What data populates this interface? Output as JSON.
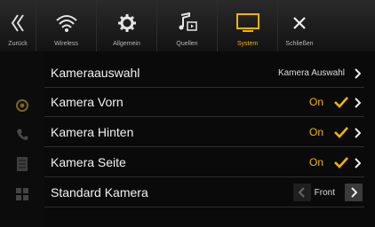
{
  "topbar": {
    "back_label": "Zurück",
    "wireless_label": "Wireless",
    "general_label": "Allgemein",
    "sources_label": "Quellen",
    "system_label": "System",
    "close_label": "Schließen"
  },
  "settings": {
    "camera_select": {
      "label": "Kameraauswahl",
      "value": "Kamera Auswahl"
    },
    "camera_front": {
      "label": "Kamera Vorn",
      "value": "On"
    },
    "camera_rear": {
      "label": "Kamera Hinten",
      "value": "On"
    },
    "camera_side": {
      "label": "Kamera Seite",
      "value": "On"
    },
    "default_camera": {
      "label": "Standard Kamera",
      "value": "Front"
    }
  },
  "colors": {
    "accent": "#f0b400",
    "background": "#000000"
  },
  "icons": [
    "back-icon",
    "wifi-icon",
    "gear-icon",
    "music-icon",
    "monitor-icon",
    "close-icon",
    "chevron-right-icon",
    "check-icon",
    "chevron-left-icon"
  ]
}
